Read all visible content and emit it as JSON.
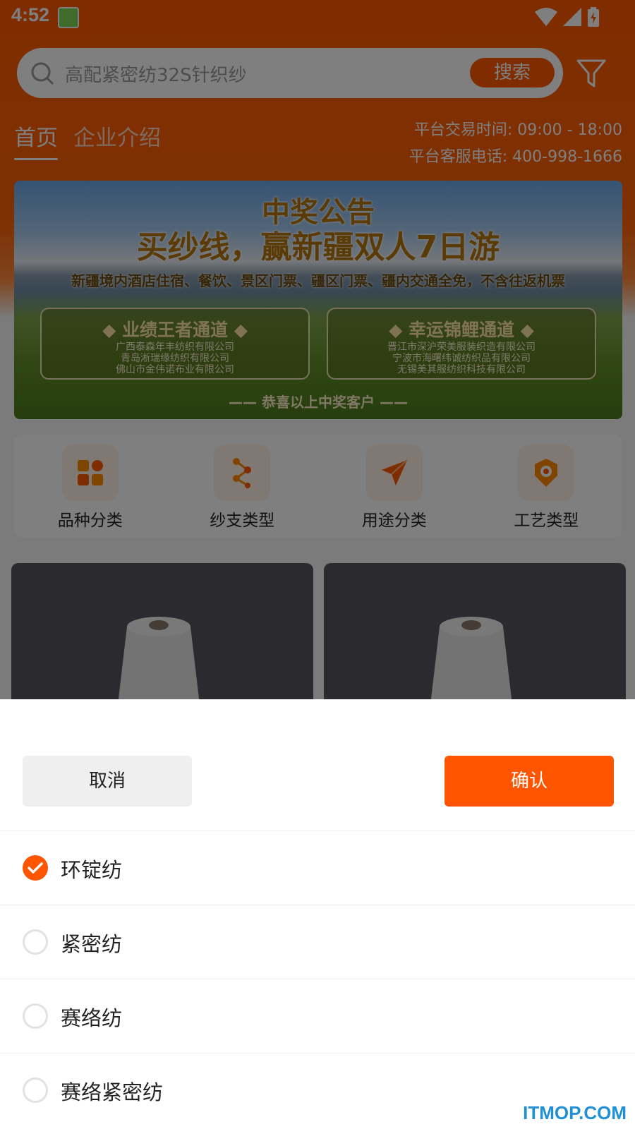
{
  "status_bar": {
    "time": "4:52"
  },
  "search": {
    "placeholder": "高配紧密纺32S针织纱",
    "button_label": "搜索"
  },
  "tabs": [
    {
      "label": "首页",
      "active": true
    },
    {
      "label": "企业介绍",
      "active": false
    }
  ],
  "platform_info": {
    "trading_hours": "平台交易时间: 09:00 - 18:00",
    "service_phone": "平台客服电话: 400-998-1666"
  },
  "banner": {
    "title_line1": "中奖公告",
    "title_line2": "买纱线，赢新疆双人7日游",
    "subtitle": "新疆境内酒店住宿、餐饮、景区门票、疆区门票、疆内交通全免，不含往返机票",
    "left_card": {
      "title": "◆ 业绩王者通道 ◆",
      "winners": [
        "广西泰森年丰纺织有限公司",
        "青岛淅瑞缘纺织有限公司",
        "佛山市金伟诺布业有限公司"
      ]
    },
    "right_card": {
      "title": "◆ 幸运锦鲤通道 ◆",
      "winners": [
        "晋江市深沪荣美服装织造有限公司",
        "宁波市海曙纬诚纺织品有限公司",
        "无锡美其服纺织科技有限公司"
      ]
    },
    "footer": "—— 恭喜以上中奖客户 ——"
  },
  "categories": [
    {
      "label": "品种分类",
      "icon": "grid-icon"
    },
    {
      "label": "纱支类型",
      "icon": "branch-icon"
    },
    {
      "label": "用途分类",
      "icon": "send-icon"
    },
    {
      "label": "工艺类型",
      "icon": "badge-icon"
    }
  ],
  "sheet": {
    "cancel_label": "取消",
    "confirm_label": "确认",
    "options": [
      {
        "label": "环锭纺",
        "checked": true
      },
      {
        "label": "紧密纺",
        "checked": false
      },
      {
        "label": "赛络纺",
        "checked": false
      },
      {
        "label": "赛络紧密纺",
        "checked": false
      }
    ]
  },
  "watermark": "ITMOP.COM",
  "colors": {
    "accent": "#ff5500",
    "header": "#ff5a00",
    "watermark": "#1f8fd6"
  }
}
